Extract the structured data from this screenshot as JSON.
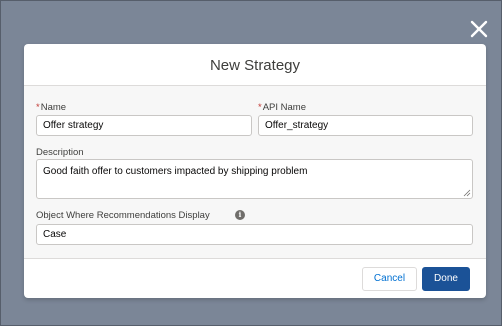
{
  "modal": {
    "title": "New Strategy"
  },
  "form": {
    "name": {
      "required_marker": "*",
      "label": "Name",
      "value": "Offer strategy"
    },
    "api_name": {
      "required_marker": "*",
      "label": "API Name",
      "value": "Offer_strategy"
    },
    "description": {
      "label": "Description",
      "value": "Good faith offer to customers impacted by shipping problem"
    },
    "object": {
      "label": "Object Where Recommendations Display",
      "info_icon": "info-icon",
      "value": "Case"
    }
  },
  "footer": {
    "cancel_label": "Cancel",
    "done_label": "Done"
  },
  "icons": {
    "close": "close-icon",
    "resize": "resize-grip-icon"
  },
  "colors": {
    "backdrop": "#7b8697",
    "brand_button": "#1b5297",
    "link_blue": "#0070d2",
    "required": "#c23934"
  }
}
